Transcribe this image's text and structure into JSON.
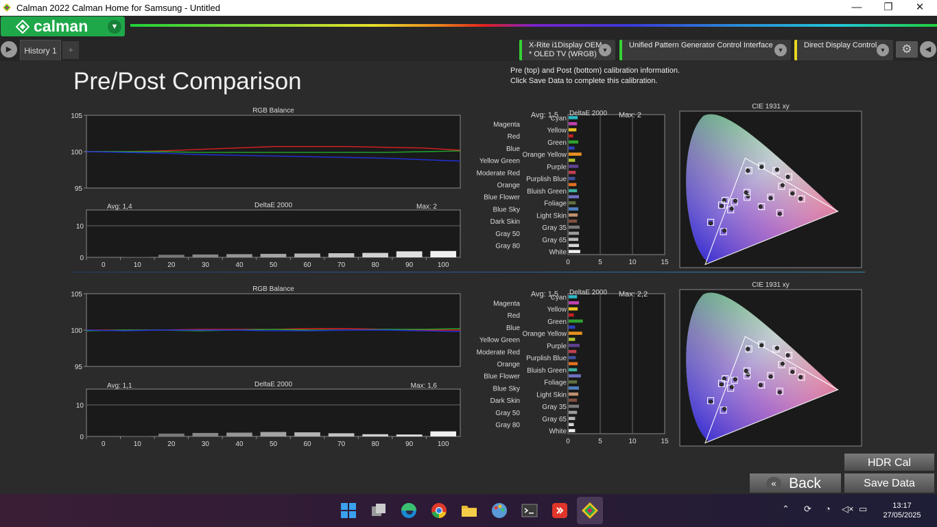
{
  "window": {
    "title": "Calman 2022 Calman Home for Samsung  - Untitled",
    "minimize": "—",
    "maximize": "❐",
    "close": "✕"
  },
  "app": {
    "logo": "calman"
  },
  "tabs": [
    {
      "label": "History 1"
    }
  ],
  "tab_add": "+",
  "devices": [
    {
      "line1": "X-Rite i1Display OEM",
      "line2": "* OLED TV (WRGB)"
    },
    {
      "line1": "Unified Pattern Generator Control Interface",
      "line2": ""
    },
    {
      "line1": "Direct Display Control",
      "line2": ""
    }
  ],
  "page": {
    "title": "Pre/Post Comparison",
    "info_line1": "Pre (top) and Post (bottom) calibration information.",
    "info_line2": "Click Save Data to complete this calibration."
  },
  "buttons": {
    "hdr": "HDR Cal",
    "back": "Back",
    "save": "Save Data"
  },
  "taskbar": {
    "time": "13:17",
    "date": "27/05/2025"
  },
  "colors": {
    "accent": "#1fa84a",
    "background": "#2b2b2b",
    "plot_bg": "#1a1a1a"
  },
  "chart_data": [
    {
      "type": "line",
      "title": "RGB Balance",
      "x": [
        0,
        10,
        20,
        30,
        40,
        50,
        60,
        70,
        80,
        90,
        100
      ],
      "ylim": [
        95,
        105
      ],
      "yticks": [
        95,
        100,
        105
      ],
      "series": [
        {
          "color": "#e02020",
          "values": [
            100.0,
            100.0,
            100.1,
            100.3,
            100.5,
            100.7,
            100.7,
            100.7,
            100.6,
            100.5,
            100.2
          ]
        },
        {
          "color": "#1fa830",
          "values": [
            100.0,
            100.0,
            100.0,
            99.9,
            99.9,
            99.9,
            99.9,
            99.9,
            99.9,
            100.0,
            100.1
          ]
        },
        {
          "color": "#2030e0",
          "values": [
            100.0,
            99.9,
            99.8,
            99.6,
            99.5,
            99.4,
            99.3,
            99.2,
            99.1,
            98.9,
            98.7
          ]
        }
      ]
    },
    {
      "type": "bar",
      "title": "DeltaE 2000",
      "avg": "Avg: 1,4",
      "max": "Max: 2",
      "categories": [
        "0",
        "10",
        "20",
        "30",
        "40",
        "50",
        "60",
        "70",
        "80",
        "90",
        "100"
      ],
      "values": [
        0,
        0.1,
        0.8,
        0.9,
        1.0,
        1.1,
        1.2,
        1.3,
        1.4,
        1.9,
        2.0
      ],
      "ylim": [
        0,
        15
      ],
      "yticks": [
        0,
        10
      ]
    },
    {
      "type": "bar",
      "title": "DeltaE 2000",
      "orientation": "horizontal",
      "avg": "Avg: 1,5",
      "max": "Max: 2",
      "xlim": [
        0,
        15
      ],
      "xticks": [
        0,
        5,
        10,
        15
      ],
      "categories": [
        "Cyan",
        "Magenta",
        "Yellow",
        "Red",
        "Green",
        "Blue",
        "Orange Yellow",
        "Yellow Green",
        "Purple",
        "Moderate Red",
        "Purplish Blue",
        "Orange",
        "Bluish Green",
        "Blue Flower",
        "Foliage",
        "Blue Sky",
        "Light Skin",
        "Dark Skin",
        "Gray 35",
        "Gray 50",
        "Gray 65",
        "Gray 80",
        "White"
      ],
      "colors": [
        "#2cb8c8",
        "#c040b0",
        "#e8c020",
        "#c82020",
        "#30a030",
        "#3040c0",
        "#e89020",
        "#b0c030",
        "#604090",
        "#c04050",
        "#4050a0",
        "#e07020",
        "#40b0a0",
        "#7070c0",
        "#607040",
        "#5080c0",
        "#c09070",
        "#805040",
        "#7a7a7a",
        "#9a9a9a",
        "#b8b8b8",
        "#d4d4d4",
        "#f0f0f0"
      ],
      "values": [
        1.4,
        1.3,
        1.2,
        0.7,
        1.5,
        0.9,
        2.0,
        1.0,
        1.5,
        1.1,
        1.0,
        1.2,
        1.3,
        1.6,
        1.1,
        1.5,
        1.4,
        1.3,
        1.7,
        1.6,
        1.5,
        1.6,
        1.8
      ]
    },
    {
      "type": "scatter",
      "title": "CIE 1931 xy"
    },
    {
      "type": "line",
      "title": "RGB Balance",
      "x": [
        0,
        10,
        20,
        30,
        40,
        50,
        60,
        70,
        80,
        90,
        100
      ],
      "ylim": [
        95,
        105
      ],
      "yticks": [
        95,
        100,
        105
      ],
      "series": [
        {
          "color": "#e02020",
          "values": [
            100.0,
            100.0,
            100.0,
            100.1,
            100.1,
            100.1,
            100.2,
            100.2,
            100.1,
            100.0,
            100.0
          ]
        },
        {
          "color": "#1fa830",
          "values": [
            99.9,
            100.0,
            100.0,
            99.9,
            100.0,
            100.1,
            100.0,
            100.0,
            100.1,
            100.1,
            100.2
          ]
        },
        {
          "color": "#2030e0",
          "values": [
            100.0,
            99.9,
            100.0,
            100.0,
            100.0,
            99.9,
            99.9,
            100.0,
            100.0,
            99.9,
            99.8
          ]
        }
      ]
    },
    {
      "type": "bar",
      "title": "DeltaE 2000",
      "avg": "Avg: 1,1",
      "max": "Max: 1,6",
      "categories": [
        "0",
        "10",
        "20",
        "30",
        "40",
        "50",
        "60",
        "70",
        "80",
        "90",
        "100"
      ],
      "values": [
        0,
        0.1,
        0.9,
        1.1,
        1.2,
        1.4,
        1.3,
        1.0,
        0.7,
        0.6,
        1.6
      ],
      "ylim": [
        0,
        15
      ],
      "yticks": [
        0,
        10
      ]
    },
    {
      "type": "bar",
      "title": "DeltaE 2000",
      "orientation": "horizontal",
      "avg": "Avg: 1,5",
      "max": "Max: 2,2",
      "xlim": [
        0,
        15
      ],
      "xticks": [
        0,
        5,
        10,
        15
      ],
      "categories": [
        "Cyan",
        "Magenta",
        "Yellow",
        "Red",
        "Green",
        "Blue",
        "Orange Yellow",
        "Yellow Green",
        "Purple",
        "Moderate Red",
        "Purplish Blue",
        "Orange",
        "Bluish Green",
        "Blue Flower",
        "Foliage",
        "Blue Sky",
        "Light Skin",
        "Dark Skin",
        "Gray 35",
        "Gray 50",
        "Gray 65",
        "Gray 80",
        "White"
      ],
      "colors": [
        "#2cb8c8",
        "#c040b0",
        "#e8c020",
        "#c82020",
        "#30a030",
        "#3040c0",
        "#e89020",
        "#b0c030",
        "#604090",
        "#c04050",
        "#4050a0",
        "#e07020",
        "#40b0a0",
        "#7070c0",
        "#607040",
        "#5080c0",
        "#c09070",
        "#805040",
        "#7a7a7a",
        "#9a9a9a",
        "#b8b8b8",
        "#d4d4d4",
        "#f0f0f0"
      ],
      "values": [
        1.3,
        1.6,
        1.4,
        0.8,
        2.2,
        1.0,
        2.1,
        1.0,
        1.7,
        1.2,
        1.1,
        1.4,
        1.3,
        1.9,
        1.3,
        1.6,
        1.5,
        1.3,
        1.6,
        1.3,
        1.0,
        0.8,
        1.0
      ]
    },
    {
      "type": "scatter",
      "title": "CIE 1931 xy"
    }
  ]
}
